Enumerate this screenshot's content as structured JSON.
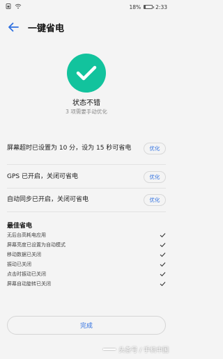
{
  "status_bar": {
    "battery_text": "18%",
    "battery_level": 0.18,
    "time": "2:33"
  },
  "header": {
    "title": "一键省电"
  },
  "status": {
    "title": "状态不错",
    "subtitle": "3 项需要手动优化"
  },
  "issues": [
    {
      "text": "屏幕超时已设置为 10 分，设为 15 秒可省电",
      "button": "优化"
    },
    {
      "text": "GPS 已开启，关闭可省电",
      "button": "优化"
    },
    {
      "text": "自动同步已开启，关闭可省电",
      "button": "优化"
    }
  ],
  "best": {
    "title": "最佳省电",
    "items": [
      "无后台高耗电应用",
      "屏幕亮度已设置为自动模式",
      "移动数据已关闭",
      "振动已关闭",
      "点击时振动已关闭",
      "屏幕自动旋转已关闭"
    ]
  },
  "done_button": "完成",
  "watermark": "头条号 / 手机中国",
  "colors": {
    "accent_green": "#12c39d",
    "link_blue": "#2f70e0",
    "background": "#f4f4f4"
  }
}
